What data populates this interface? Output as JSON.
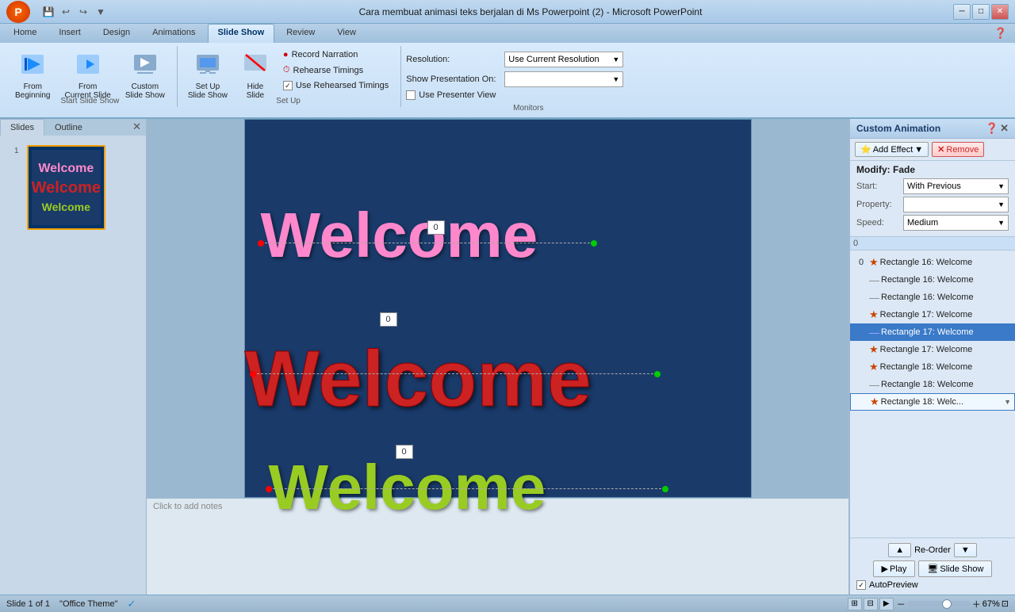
{
  "titlebar": {
    "title": "Cara membuat animasi teks berjalan di Ms Powerpoint (2) - Microsoft PowerPoint",
    "min_btn": "─",
    "max_btn": "□",
    "close_btn": "✕",
    "save_btn": "💾",
    "undo_btn": "↩",
    "redo_btn": "↪"
  },
  "ribbon": {
    "tabs": [
      "Home",
      "Insert",
      "Design",
      "Animations",
      "Slide Show",
      "Review",
      "View"
    ],
    "active_tab": "Slide Show",
    "groups": {
      "start_slide_show": {
        "label": "Start Slide Show",
        "from_beginning": "From\nBeginning",
        "from_current": "From\nCurrent Slide",
        "custom_show": "Custom\nSlide Show",
        "setup": "Set Up\nSlide Show",
        "hide": "Hide\nSlide"
      },
      "setup": {
        "label": "Set Up",
        "record_narration": "Record Narration",
        "rehearse_timings": "Rehearse Timings",
        "use_rehearsed": "Use Rehearsed Timings"
      },
      "monitors": {
        "label": "Monitors",
        "resolution_label": "Resolution:",
        "resolution_value": "Use Current Resolution",
        "show_on_label": "Show Presentation On:",
        "show_on_value": "",
        "presenter_view": "Use Presenter View"
      }
    }
  },
  "slides_panel": {
    "tabs": [
      "Slides",
      "Outline"
    ],
    "slide_num": "1",
    "thumbnail": {
      "texts": [
        {
          "text": "Welcome",
          "color": "#ff88cc"
        },
        {
          "text": "Welcome",
          "color": "#cc2222"
        },
        {
          "text": "Welcome",
          "color": "#99cc22"
        }
      ]
    }
  },
  "slide": {
    "texts": [
      {
        "text": "Welcome",
        "color": "#ff88cc",
        "top": "130",
        "left": "50",
        "size": "80"
      },
      {
        "text": "Welcome",
        "color": "#cc2222",
        "top": "295",
        "left": "30",
        "size": "90"
      },
      {
        "text": "Welcome",
        "color": "#99cc22",
        "top": "455",
        "left": "60",
        "size": "80"
      }
    ],
    "counters": [
      {
        "value": "0",
        "top": "127",
        "left": "225"
      },
      {
        "value": "0",
        "top": "243",
        "left": "162"
      },
      {
        "value": "0",
        "top": "410",
        "left": "178"
      }
    ]
  },
  "custom_animation": {
    "title": "Custom Animation",
    "add_effect_label": "Add Effect",
    "remove_label": "Remove",
    "modify_title": "Modify: Fade",
    "start_label": "Start:",
    "start_value": "With Previous",
    "property_label": "Property:",
    "property_value": "",
    "speed_label": "Speed:",
    "speed_value": "Medium",
    "items": [
      {
        "num": "0",
        "icon": "star",
        "text": "Rectangle 16: Welcome",
        "selected": false
      },
      {
        "num": "",
        "icon": "dash",
        "text": "Rectangle 16: Welcome",
        "selected": false
      },
      {
        "num": "",
        "icon": "dash",
        "text": "Rectangle 16: Welcome",
        "selected": false
      },
      {
        "num": "",
        "icon": "star",
        "text": "Rectangle 17: Welcome",
        "selected": false
      },
      {
        "num": "",
        "icon": "dash",
        "text": "Rectangle 17: Welcome",
        "selected": true
      },
      {
        "num": "",
        "icon": "star",
        "text": "Rectangle 17: Welcome",
        "selected": false
      },
      {
        "num": "",
        "icon": "star",
        "text": "Rectangle 18: Welcome",
        "selected": false
      },
      {
        "num": "",
        "icon": "dash",
        "text": "Rectangle 18: Welcome",
        "selected": false
      },
      {
        "num": "",
        "icon": "star",
        "text": "Rectangle 18: Welc...",
        "selected": false,
        "has_arrow": true
      }
    ],
    "reorder_up": "Re-Order",
    "play_label": "Play",
    "slideshow_label": "Slide Show",
    "autopreview_label": "AutoPreview"
  },
  "statusbar": {
    "slide_info": "Slide 1 of 1",
    "theme": "\"Office Theme\"",
    "zoom_level": "67%",
    "note_placeholder": "Click to add notes"
  }
}
